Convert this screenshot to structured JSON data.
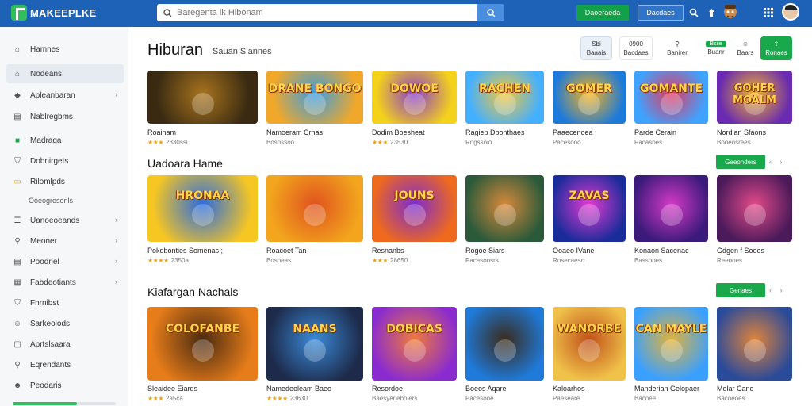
{
  "topbar": {
    "logo_text": "MAKEEPLKE",
    "search_placeholder": "Baregenta lk Hibonam",
    "green_button": "Daoeraeda",
    "outline_button": "Dacdaes",
    "icons": [
      "search-icon",
      "question-icon",
      "rocket-icon",
      "grid-icon"
    ]
  },
  "sidebar": {
    "items": [
      {
        "label": "Hamnes",
        "icon": "home-icon",
        "chevron": false
      },
      {
        "label": "Nodeans",
        "icon": "home-icon",
        "chevron": false
      },
      {
        "label": "Apleanbaran",
        "icon": "tag-icon",
        "chevron": true
      },
      {
        "label": "Nablregbms",
        "icon": "doc-icon",
        "chevron": false
      },
      {
        "label": "Madraga",
        "icon": "green-square-icon",
        "chevron": false
      },
      {
        "label": "Dobnirgets",
        "icon": "shield-icon",
        "chevron": false
      },
      {
        "label": "Rilomlpds",
        "icon": "folder-icon",
        "chevron": false
      }
    ],
    "sub_label": "Ooeogresonls",
    "items2": [
      {
        "label": "Uanoeoeands",
        "icon": "list-icon",
        "chevron": true
      },
      {
        "label": "Meoner",
        "icon": "pin-icon",
        "chevron": true
      },
      {
        "label": "Poodriel",
        "icon": "doc-icon",
        "chevron": true
      },
      {
        "label": "Fabdeotiants",
        "icon": "chart-icon",
        "chevron": true
      },
      {
        "label": "Fhrnibst",
        "icon": "shield-icon",
        "chevron": false
      },
      {
        "label": "Sarkeolods",
        "icon": "user-icon",
        "chevron": false
      },
      {
        "label": "Aprtslsaara",
        "icon": "chat-icon",
        "chevron": false
      },
      {
        "label": "Eqrendants",
        "icon": "pin-icon",
        "chevron": false
      },
      {
        "label": "Peodaris",
        "icon": "people-icon",
        "chevron": false
      }
    ],
    "progress": 0.62
  },
  "header": {
    "title": "Hiburan",
    "subtitle": "Sauan Slannes",
    "buttons": [
      {
        "top": "Sbi",
        "bottom": "Baaais"
      },
      {
        "top": "0900",
        "bottom": "Bacdaes"
      },
      {
        "top": "⚲",
        "bottom": "Banirer"
      },
      {
        "top": "Bsiie",
        "bottom": "Buanr"
      },
      {
        "top": "☺",
        "bottom": "Baars"
      },
      {
        "top": "⇪",
        "bottom": "Ronaes"
      }
    ]
  },
  "sections": [
    {
      "title": "",
      "cards": [
        {
          "name": "Roainam",
          "meta": "2330ssi",
          "stars": "★★★",
          "word": ""
        },
        {
          "name": "Namoeram Crnas",
          "meta": "Bosossoo",
          "stars": "",
          "word": "DRANE BONGO"
        },
        {
          "name": "Dodim Boesheat",
          "meta": "23530",
          "stars": "★★★",
          "word": "DOWOE"
        },
        {
          "name": "Ragiep Dbonthaes",
          "meta": "Rogssoio",
          "stars": "",
          "word": "RACHEN"
        },
        {
          "name": "Paaecenoea",
          "meta": "Pacesooo",
          "stars": "",
          "word": "GOMER"
        },
        {
          "name": "Parde Cerain",
          "meta": "Pacasoes",
          "stars": "",
          "word": "GOMANTE"
        },
        {
          "name": "Nordian Sfaons",
          "meta": "Booeosrees",
          "stars": "",
          "word": "GOHER MOALM"
        }
      ]
    },
    {
      "title": "Uadoara Hame",
      "see_label": "Geeonders",
      "cards": [
        {
          "name": "Pokdbonties Somenas ;",
          "meta": "2350a",
          "stars": "★★★★",
          "word": "HRONAA"
        },
        {
          "name": "Roacoet Tan",
          "meta": "Bosoeas",
          "stars": "",
          "word": ""
        },
        {
          "name": "Resnanbs",
          "meta": "28650",
          "stars": "★★★",
          "word": "JOUNS"
        },
        {
          "name": "Rogoe Siars",
          "meta": "Pacesoosrs",
          "stars": "",
          "word": ""
        },
        {
          "name": "Ooaeo IVane",
          "meta": "Rosecaeso",
          "stars": "",
          "word": "ZAVAS"
        },
        {
          "name": "Konaon Sacenac",
          "meta": "Bassooes",
          "stars": "",
          "word": ""
        },
        {
          "name": "Gdgen f Sooes",
          "meta": "Reeooes",
          "stars": "",
          "word": ""
        }
      ]
    },
    {
      "title": "Kiafargan Nachals",
      "see_label": "Genaes",
      "cards": [
        {
          "name": "Sleaidee Eiards",
          "meta": "2a5ca",
          "stars": "★★★",
          "word": "COLOFANBE"
        },
        {
          "name": "Namedeoleam Baeo",
          "meta": "23630",
          "stars": "★★★★",
          "word": "NAANS"
        },
        {
          "name": "Resordoe",
          "meta": "Baesyerieboiers",
          "stars": "",
          "word": "DOBICAS"
        },
        {
          "name": "Boeos Aqare",
          "meta": "Pacesooe",
          "stars": "",
          "word": ""
        },
        {
          "name": "Kaloarhos",
          "meta": "Paeseare",
          "stars": "",
          "word": "WANORBE"
        },
        {
          "name": "Manderian Gelopaer",
          "meta": "Bacoee",
          "stars": "",
          "word": "CAN MAYLE"
        },
        {
          "name": "Molar Cano",
          "meta": "Bacoeoes",
          "stars": "",
          "word": ""
        }
      ]
    }
  ],
  "colors": {
    "topbar": "#1e62b8",
    "accent_green": "#19a84c",
    "sidebar_bg": "#f6f7f9"
  }
}
